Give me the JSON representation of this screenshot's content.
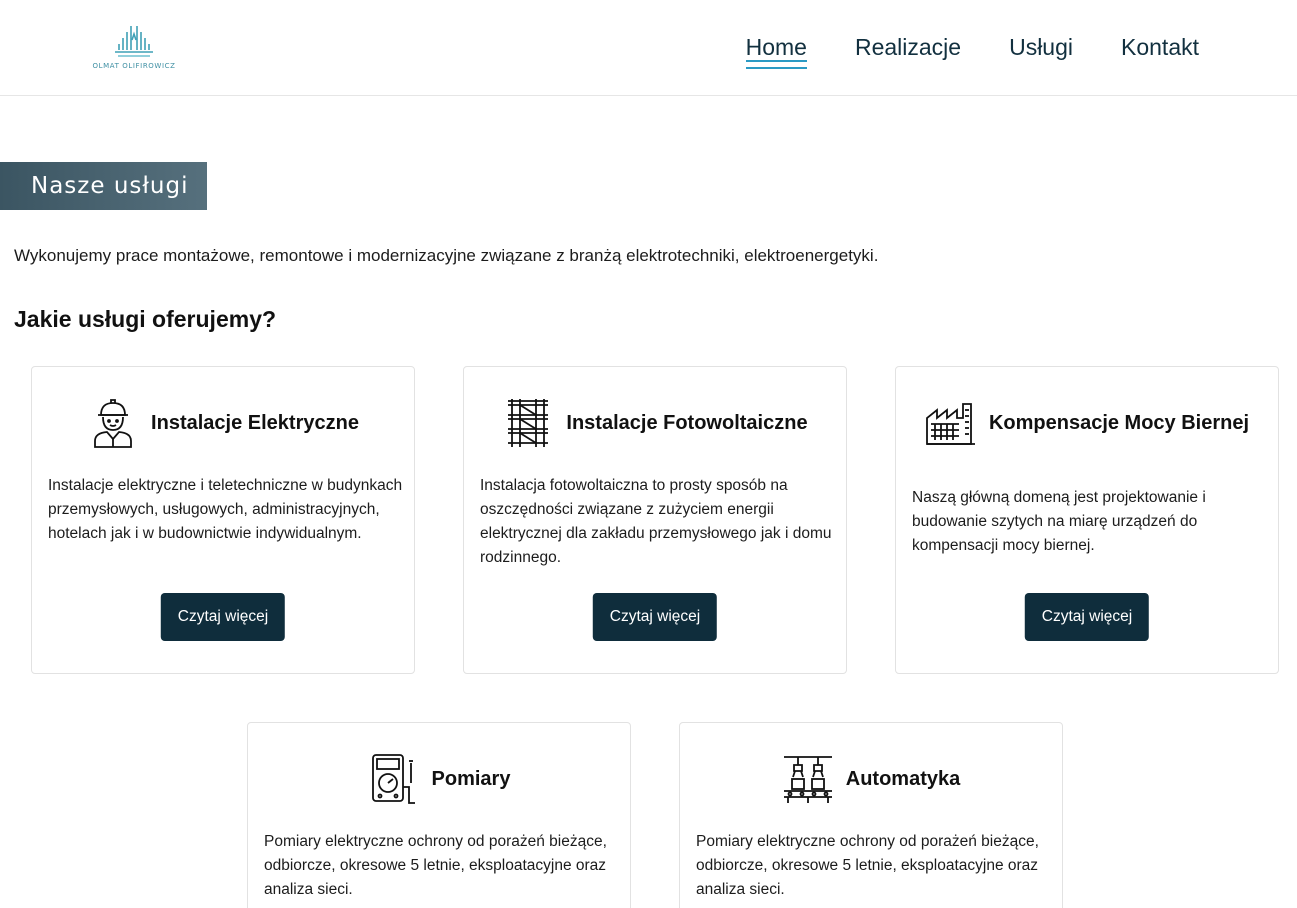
{
  "header": {
    "logo_text": "OLMAT OLIFIROWICZ",
    "nav": [
      {
        "label": "Home",
        "active": true
      },
      {
        "label": "Realizacje",
        "active": false
      },
      {
        "label": "Usługi",
        "active": false
      },
      {
        "label": "Kontakt",
        "active": false
      }
    ]
  },
  "banner": {
    "title": "Nasze usługi"
  },
  "intro": "Wykonujemy prace montażowe, remontowe i modernizacyjne związane z branżą elektrotechniki, elektroenergetyki.",
  "subtitle": "Jakie usługi oferujemy?",
  "cards": [
    {
      "title": "Instalacje Elektryczne",
      "icon": "electrician-icon",
      "text": "Instalacje elektryczne i teletechniczne w budynkach przemysłowych, usługowych, administracyjnych, hotelach jak i w budownictwie indywidualnym.",
      "button": "Czytaj więcej"
    },
    {
      "title": "Instalacje Fotowoltaiczne",
      "icon": "scaffolding-icon",
      "text": "Instalacja fotowoltaiczna to prosty sposób na oszczędności związane z zużyciem energii elektrycznej dla zakładu przemysłowego jak i domu rodzinnego.",
      "button": "Czytaj więcej"
    },
    {
      "title": "Kompensacje Mocy Biernej",
      "icon": "factory-icon",
      "text": "Naszą główną domeną jest projektowanie i budowanie szytych na miarę urządzeń do kompensacji mocy biernej.",
      "button": "Czytaj więcej"
    },
    {
      "title": "Pomiary",
      "icon": "multimeter-icon",
      "text": "Pomiary elektryczne ochrony od porażeń bieżące, odbiorcze, okresowe 5 letnie, eksploatacyjne oraz analiza sieci."
    },
    {
      "title": "Automatyka",
      "icon": "robotic-assembly-icon",
      "text": "Pomiary elektryczne ochrony od porażeń bieżące, odbiorcze, okresowe 5 letnie, eksploatacyjne oraz analiza sieci."
    }
  ],
  "colors": {
    "accent": "#2b9ac4",
    "button_bg": "#0f2d3c",
    "nav_text": "#12303f",
    "banner_bg": "#4a6470"
  }
}
